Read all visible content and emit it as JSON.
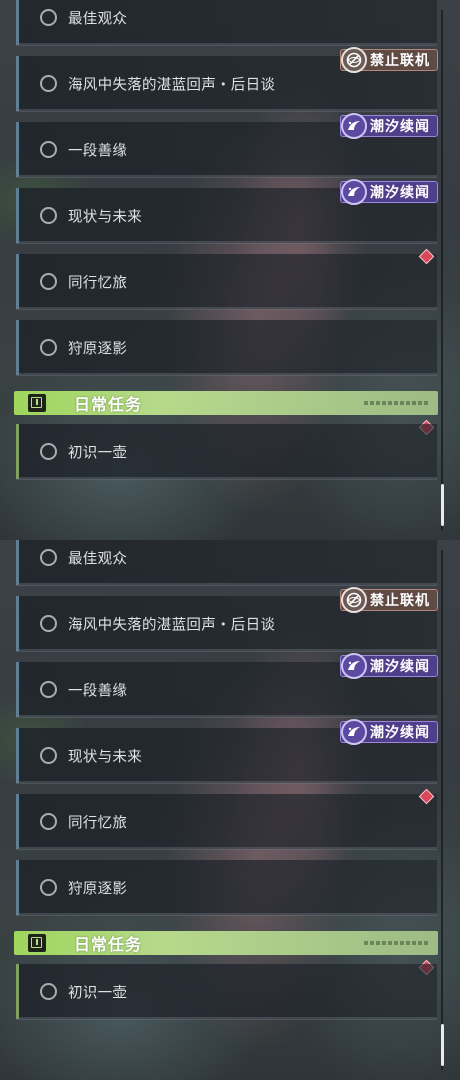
{
  "panels": [
    {
      "quests": [
        {
          "label": "最佳观众"
        },
        {
          "label": "海风中失落的湛蓝回声・后日谈"
        },
        {
          "label": "一段善缘"
        },
        {
          "label": "现状与未来"
        },
        {
          "label": "同行忆旅"
        },
        {
          "label": "狩原逐影"
        }
      ],
      "tags": {
        "no_coop": "禁止联机",
        "tide_1": "潮汐续闻",
        "tide_2": "潮汐续闻"
      },
      "section": {
        "title": "日常任务"
      },
      "daily_quests": [
        {
          "label": "初识一壶"
        }
      ]
    },
    {
      "quests": [
        {
          "label": "最佳观众"
        },
        {
          "label": "海风中失落的湛蓝回声・后日谈"
        },
        {
          "label": "一段善缘"
        },
        {
          "label": "现状与未来"
        },
        {
          "label": "同行忆旅"
        },
        {
          "label": "狩原逐影"
        }
      ],
      "tags": {
        "no_coop": "禁止联机",
        "tide_1": "潮汐续闻",
        "tide_2": "潮汐续闻"
      },
      "section": {
        "title": "日常任务"
      },
      "daily_quests": [
        {
          "label": "初识一壶"
        }
      ]
    }
  ],
  "colors": {
    "tag_no_coop": "#5f4a44",
    "tag_tide": "#4f3f8b",
    "section_header": "#9fd65c",
    "alert_diamond": "#d9475a"
  },
  "icons": {
    "no_coop": "no-coop-icon",
    "tide": "tide-wave-icon",
    "section": "daily-quest-icon",
    "quest_status": "quest-status-circle",
    "alert": "alert-diamond"
  }
}
